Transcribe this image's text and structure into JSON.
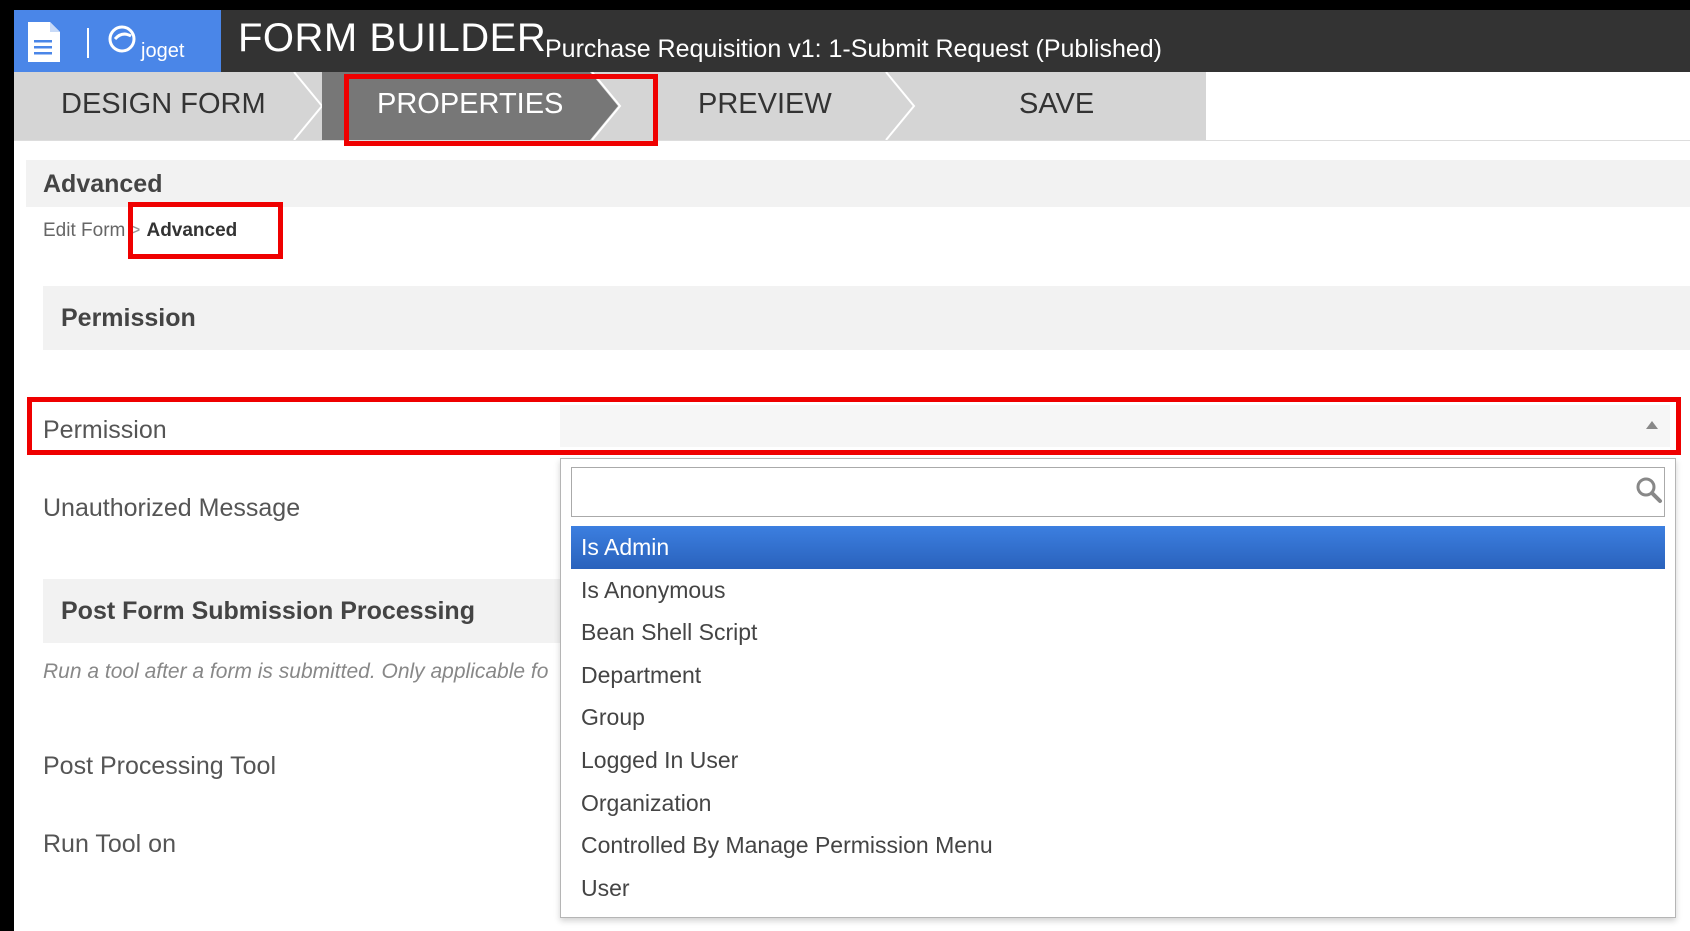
{
  "header": {
    "logo_text": "joget",
    "app_title": "FORM BUILDER",
    "form_subtitle": "Purchase Requisition v1: 1-Submit Request (Published)"
  },
  "steps": [
    {
      "label": "DESIGN FORM",
      "active": false
    },
    {
      "label": "PROPERTIES",
      "active": true
    },
    {
      "label": "PREVIEW",
      "active": false
    },
    {
      "label": "SAVE",
      "active": false
    }
  ],
  "section": {
    "title": "Advanced"
  },
  "breadcrumb": {
    "parent": "Edit Form",
    "separator": ">",
    "current": "Advanced"
  },
  "groups": {
    "permission": {
      "title": "Permission"
    },
    "post_submission": {
      "title": "Post Form Submission Processing",
      "note": "Run a tool after a form is submitted. Only applicable fo"
    }
  },
  "fields": {
    "permission": {
      "label": "Permission",
      "value": ""
    },
    "unauthorized_message": {
      "label": "Unauthorized Message"
    },
    "post_processing_tool": {
      "label": "Post Processing Tool"
    },
    "run_tool_on": {
      "label": "Run Tool on"
    }
  },
  "dropdown": {
    "search_value": "",
    "options": [
      "Is Admin",
      "Is Anonymous",
      "Bean Shell Script",
      "Department",
      "Group",
      "Logged In User",
      "Organization",
      "Controlled By Manage Permission Menu",
      "User"
    ],
    "selected": "Is Admin"
  },
  "colors": {
    "header_bg": "#333333",
    "logo_bg": "#4a86e8",
    "active_step_bg": "#777777",
    "inactive_step_bg": "#d5d5d5",
    "highlight": "#ef0000",
    "selected_option": "#3875d7"
  }
}
